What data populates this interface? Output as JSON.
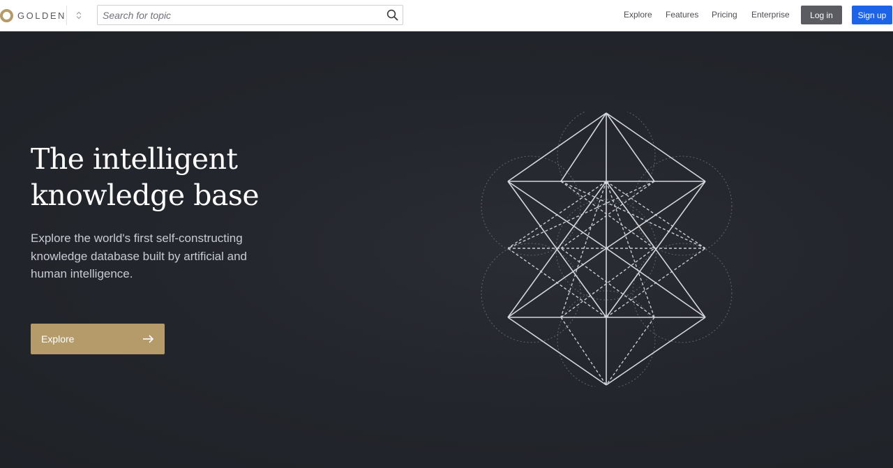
{
  "brand": {
    "name": "GOLDEN",
    "accent": "#b59a6a"
  },
  "search": {
    "placeholder": "Search for topic",
    "value": ""
  },
  "nav": {
    "explore": "Explore",
    "features": "Features",
    "pricing": "Pricing",
    "enterprise": "Enterprise",
    "login": "Log in",
    "signup": "Sign up",
    "signup_color": "#1d63e8",
    "login_color": "#5a5c62"
  },
  "hero": {
    "title_line1": "The intelligent",
    "title_line2": "knowledge base",
    "subtitle": "Explore the world's first self-constructing knowledge database built by artificial and human intelligence.",
    "cta_label": "Explore",
    "background": "#23262c"
  },
  "icons": {
    "logo": "golden-ring-icon",
    "switcher": "chevron-up-down-icon",
    "search": "search-icon",
    "cta": "arrow-right-icon",
    "illustration": "sacred-geometry-icon"
  }
}
